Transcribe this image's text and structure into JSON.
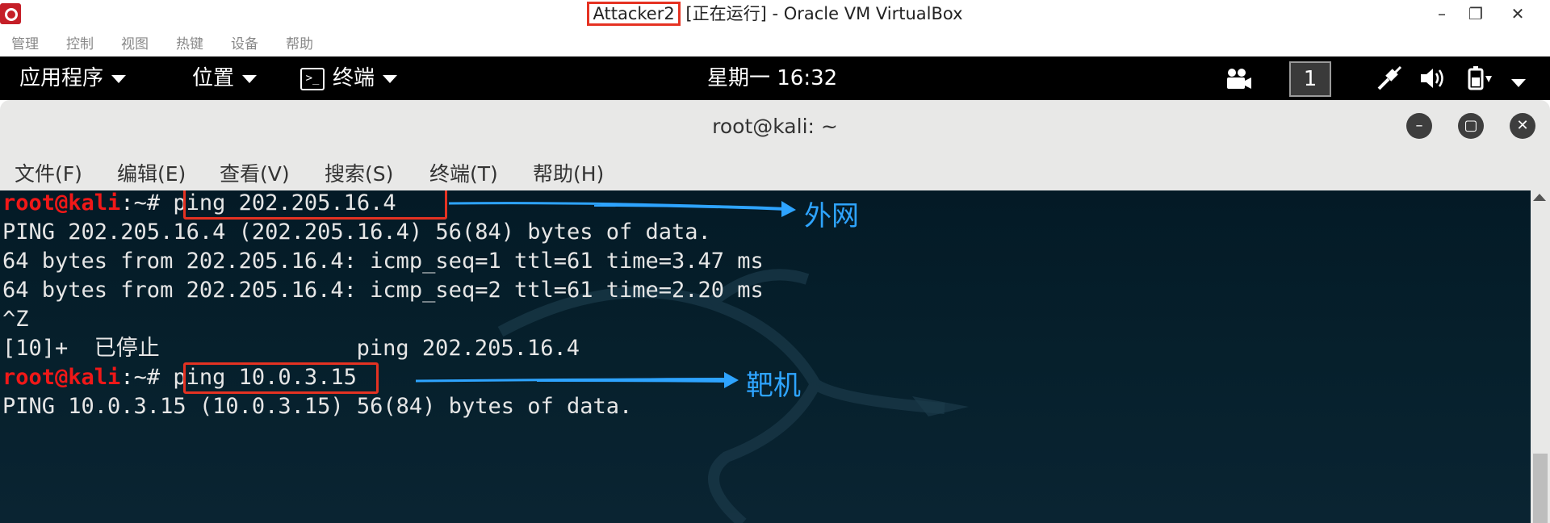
{
  "host_window": {
    "title_highlight": "Attacker2",
    "title_rest": " [正在运行] - Oracle VM VirtualBox",
    "minimize": "–",
    "maximize": "❐",
    "close": "✕"
  },
  "host_menu": [
    "管理",
    "控制",
    "视图",
    "热键",
    "设备",
    "帮助"
  ],
  "kali_bar": {
    "applications": "应用程序",
    "places": "位置",
    "terminal": "终端",
    "clock": "星期一 16:32",
    "workspace": "1"
  },
  "terminal": {
    "title": "root@kali: ~",
    "menu": [
      "文件(F)",
      "编辑(E)",
      "查看(V)",
      "搜索(S)",
      "终端(T)",
      "帮助(H)"
    ],
    "prompt_user": "root@kali",
    "prompt_sep": ":~#",
    "lines": {
      "cmd1": " ping 202.205.16.4",
      "out1": "PING 202.205.16.4 (202.205.16.4) 56(84) bytes of data.",
      "out2": "64 bytes from 202.205.16.4: icmp_seq=1 ttl=61 time=3.47 ms",
      "out3": "64 bytes from 202.205.16.4: icmp_seq=2 ttl=61 time=2.20 ms",
      "out4": "^Z",
      "out5": "[10]+  已停止               ping 202.205.16.4",
      "cmd2": " ping 10.0.3.15",
      "out6": "PING 10.0.3.15 (10.0.3.15) 56(84) bytes of data."
    }
  },
  "annotations": {
    "arrow1_label": "外网",
    "arrow2_label": "靶机",
    "highlight_color": "#e53222",
    "arrow_color": "#2ea4ff"
  }
}
